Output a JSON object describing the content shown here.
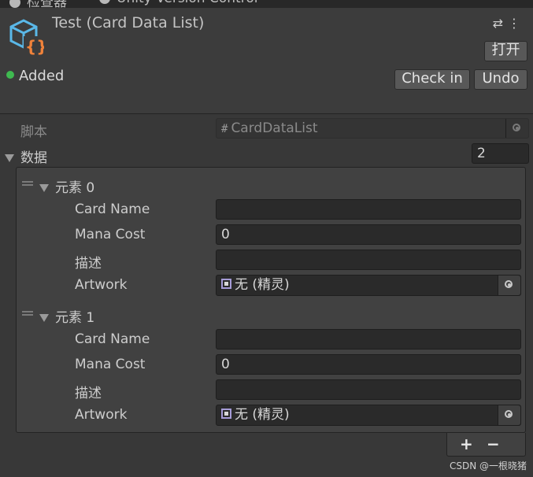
{
  "tabs": [
    "检查器",
    "Unity Version Control"
  ],
  "header": {
    "title": "Test (Card Data List)",
    "open_label": "打开",
    "status": "Added",
    "checkin_label": "Check in",
    "undo_label": "Undo"
  },
  "script_row": {
    "label": "脚本",
    "value": "CardDataList"
  },
  "data_row": {
    "label": "数据",
    "count": "2"
  },
  "fields": {
    "card_name": "Card Name",
    "mana_cost": "Mana Cost",
    "description": "描述",
    "artwork": "Artwork"
  },
  "elements": [
    {
      "label": "元素 0",
      "card_name": "",
      "mana_cost": "0",
      "description": "",
      "artwork": "无 (精灵)"
    },
    {
      "label": "元素 1",
      "card_name": "",
      "mana_cost": "0",
      "description": "",
      "artwork": "无 (精灵)"
    }
  ],
  "list_footer": {
    "add": "+",
    "remove": "−"
  },
  "watermark": "CSDN @一根晓猪",
  "colors": {
    "accent_green": "#3fb950",
    "icon_blue": "#5ab8e8",
    "icon_orange": "#f0823a"
  }
}
